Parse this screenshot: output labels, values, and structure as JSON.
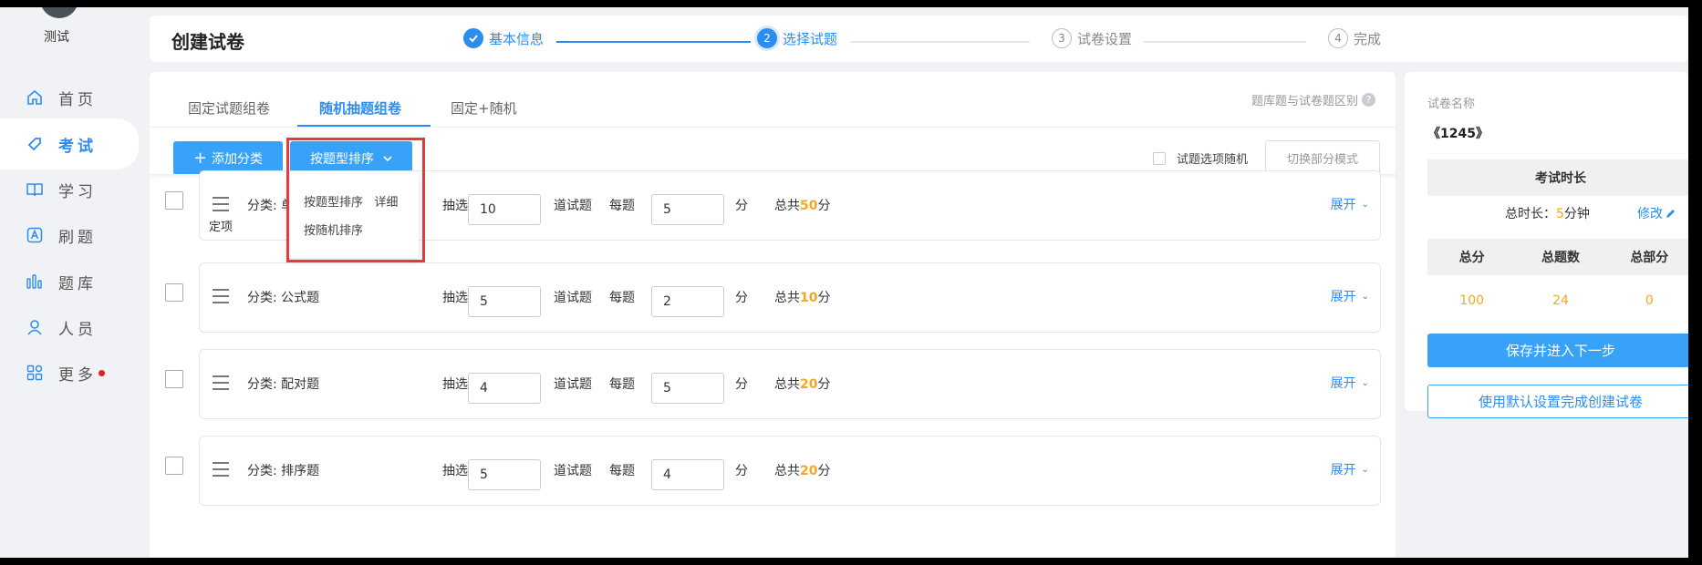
{
  "user": {
    "name": "测试"
  },
  "nav": [
    {
      "label": "首页",
      "icon": "home-icon"
    },
    {
      "label": "考试",
      "icon": "tag-icon",
      "active": true
    },
    {
      "label": "学习",
      "icon": "book-icon"
    },
    {
      "label": "刷题",
      "icon": "letter-a-icon"
    },
    {
      "label": "题库",
      "icon": "bars-icon"
    },
    {
      "label": "人员",
      "icon": "person-icon"
    },
    {
      "label": "更多",
      "icon": "apps-icon",
      "badge_dot": true
    }
  ],
  "header": {
    "title": "创建试卷",
    "steps": [
      {
        "num": "✓",
        "label": "基本信息",
        "state": "done"
      },
      {
        "num": "2",
        "label": "选择试题",
        "state": "current"
      },
      {
        "num": "3",
        "label": "试卷设置",
        "state": "todo"
      },
      {
        "num": "4",
        "label": "完成",
        "state": "todo"
      }
    ]
  },
  "tabs": {
    "fixed": "固定试题组卷",
    "random": "随机抽题组卷",
    "mixed": "固定+随机"
  },
  "help_link": "题库题与试卷题区别",
  "toolbar": {
    "add_category": "添加分类",
    "sort_select": "按题型排序",
    "random_option": "试题选项随机",
    "switch_mode": "切换部分模式"
  },
  "sort_dropdown": {
    "option1": "按题型排序",
    "option1_extra": "详细",
    "option2": "按随机排序"
  },
  "row_labels": {
    "pick": "抽选",
    "questions": "道试题",
    "each": "每题",
    "points": "分",
    "total_prefix": "总共",
    "total_suffix": "分",
    "expand": "展开"
  },
  "rows": [
    {
      "category": "分类: 单",
      "category_extra": "定项",
      "count": "10",
      "score": "5",
      "total": "50"
    },
    {
      "category": "分类: 公式题",
      "count": "5",
      "score": "2",
      "total": "10"
    },
    {
      "category": "分类: 配对题",
      "count": "4",
      "score": "5",
      "total": "20"
    },
    {
      "category": "分类: 排序题",
      "count": "5",
      "score": "4",
      "total": "20"
    }
  ],
  "summary": {
    "name_label": "试卷名称",
    "name": "《1245》",
    "duration_header": "考试时长",
    "duration_prefix": "总时长：",
    "duration_value": "5",
    "duration_unit": "分钟",
    "edit": "修改",
    "cols": [
      "总分",
      "总题数",
      "总部分"
    ],
    "values": [
      "100",
      "24",
      "0"
    ],
    "save_next": "保存并进入下一步",
    "use_default": "使用默认设置完成创建试卷"
  },
  "colors": {
    "accent": "#2d8cf0",
    "button": "#37a2f8",
    "highlight": "#f5a623",
    "annotation": "#e33b3b"
  }
}
